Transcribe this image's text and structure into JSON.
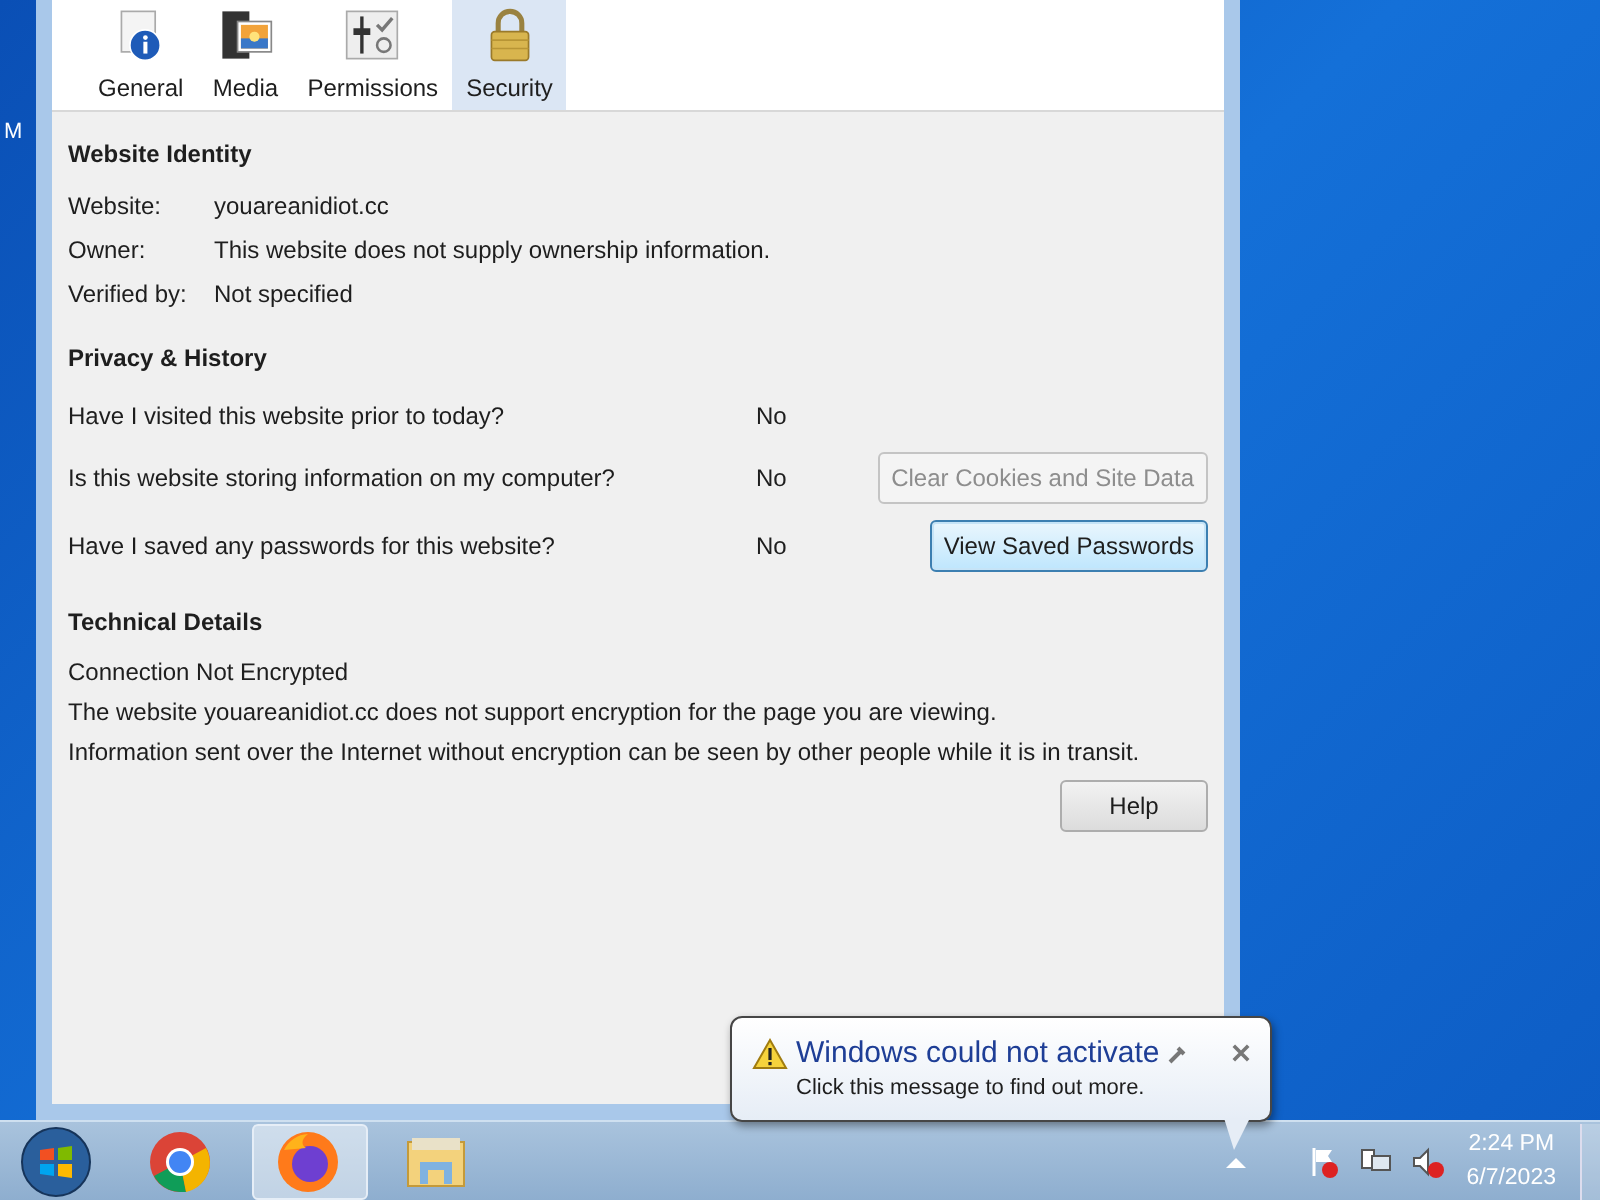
{
  "desktop": {
    "icon_label": "M"
  },
  "window": {
    "tabs": [
      {
        "label": "General",
        "selected": false
      },
      {
        "label": "Media",
        "selected": false
      },
      {
        "label": "Permissions",
        "selected": false
      },
      {
        "label": "Security",
        "selected": true
      }
    ],
    "sections": [
      {
        "title": "Website Identity",
        "rows": [
          {
            "label": "Website:",
            "value": "youareanidiot.cc"
          },
          {
            "label": "Owner:",
            "value": "This website does not supply ownership information."
          },
          {
            "label": "Verified by:",
            "value": "Not specified"
          }
        ]
      },
      {
        "title": "Privacy & History",
        "questions": [
          {
            "text": "Have I visited this website prior to today?",
            "answer": "No"
          },
          {
            "text": "Is this website storing information on my computer?",
            "answer": "No",
            "button": {
              "label": "Clear Cookies and Site Data",
              "disabled": true,
              "focused": false
            }
          },
          {
            "text": "Have I saved any passwords for this website?",
            "answer": "No",
            "button": {
              "label": "View Saved Passwords",
              "disabled": false,
              "focused": true
            }
          }
        ]
      },
      {
        "title": "Technical Details",
        "lines": [
          "Connection Not Encrypted",
          "The website youareanidiot.cc does not support encryption for the page you are viewing.",
          "Information sent over the Internet without encryption can be seen by other people while it is in transit."
        ],
        "button": {
          "label": "Help",
          "disabled": false,
          "focused": false
        }
      }
    ]
  },
  "notification": {
    "title": "Windows could not activate",
    "message": "Click this message to find out more."
  },
  "taskbar": {
    "apps": [
      {
        "active": false
      },
      {
        "active": true
      },
      {
        "active": false
      }
    ],
    "time": "2:24 PM",
    "date": "6/7/2023"
  }
}
